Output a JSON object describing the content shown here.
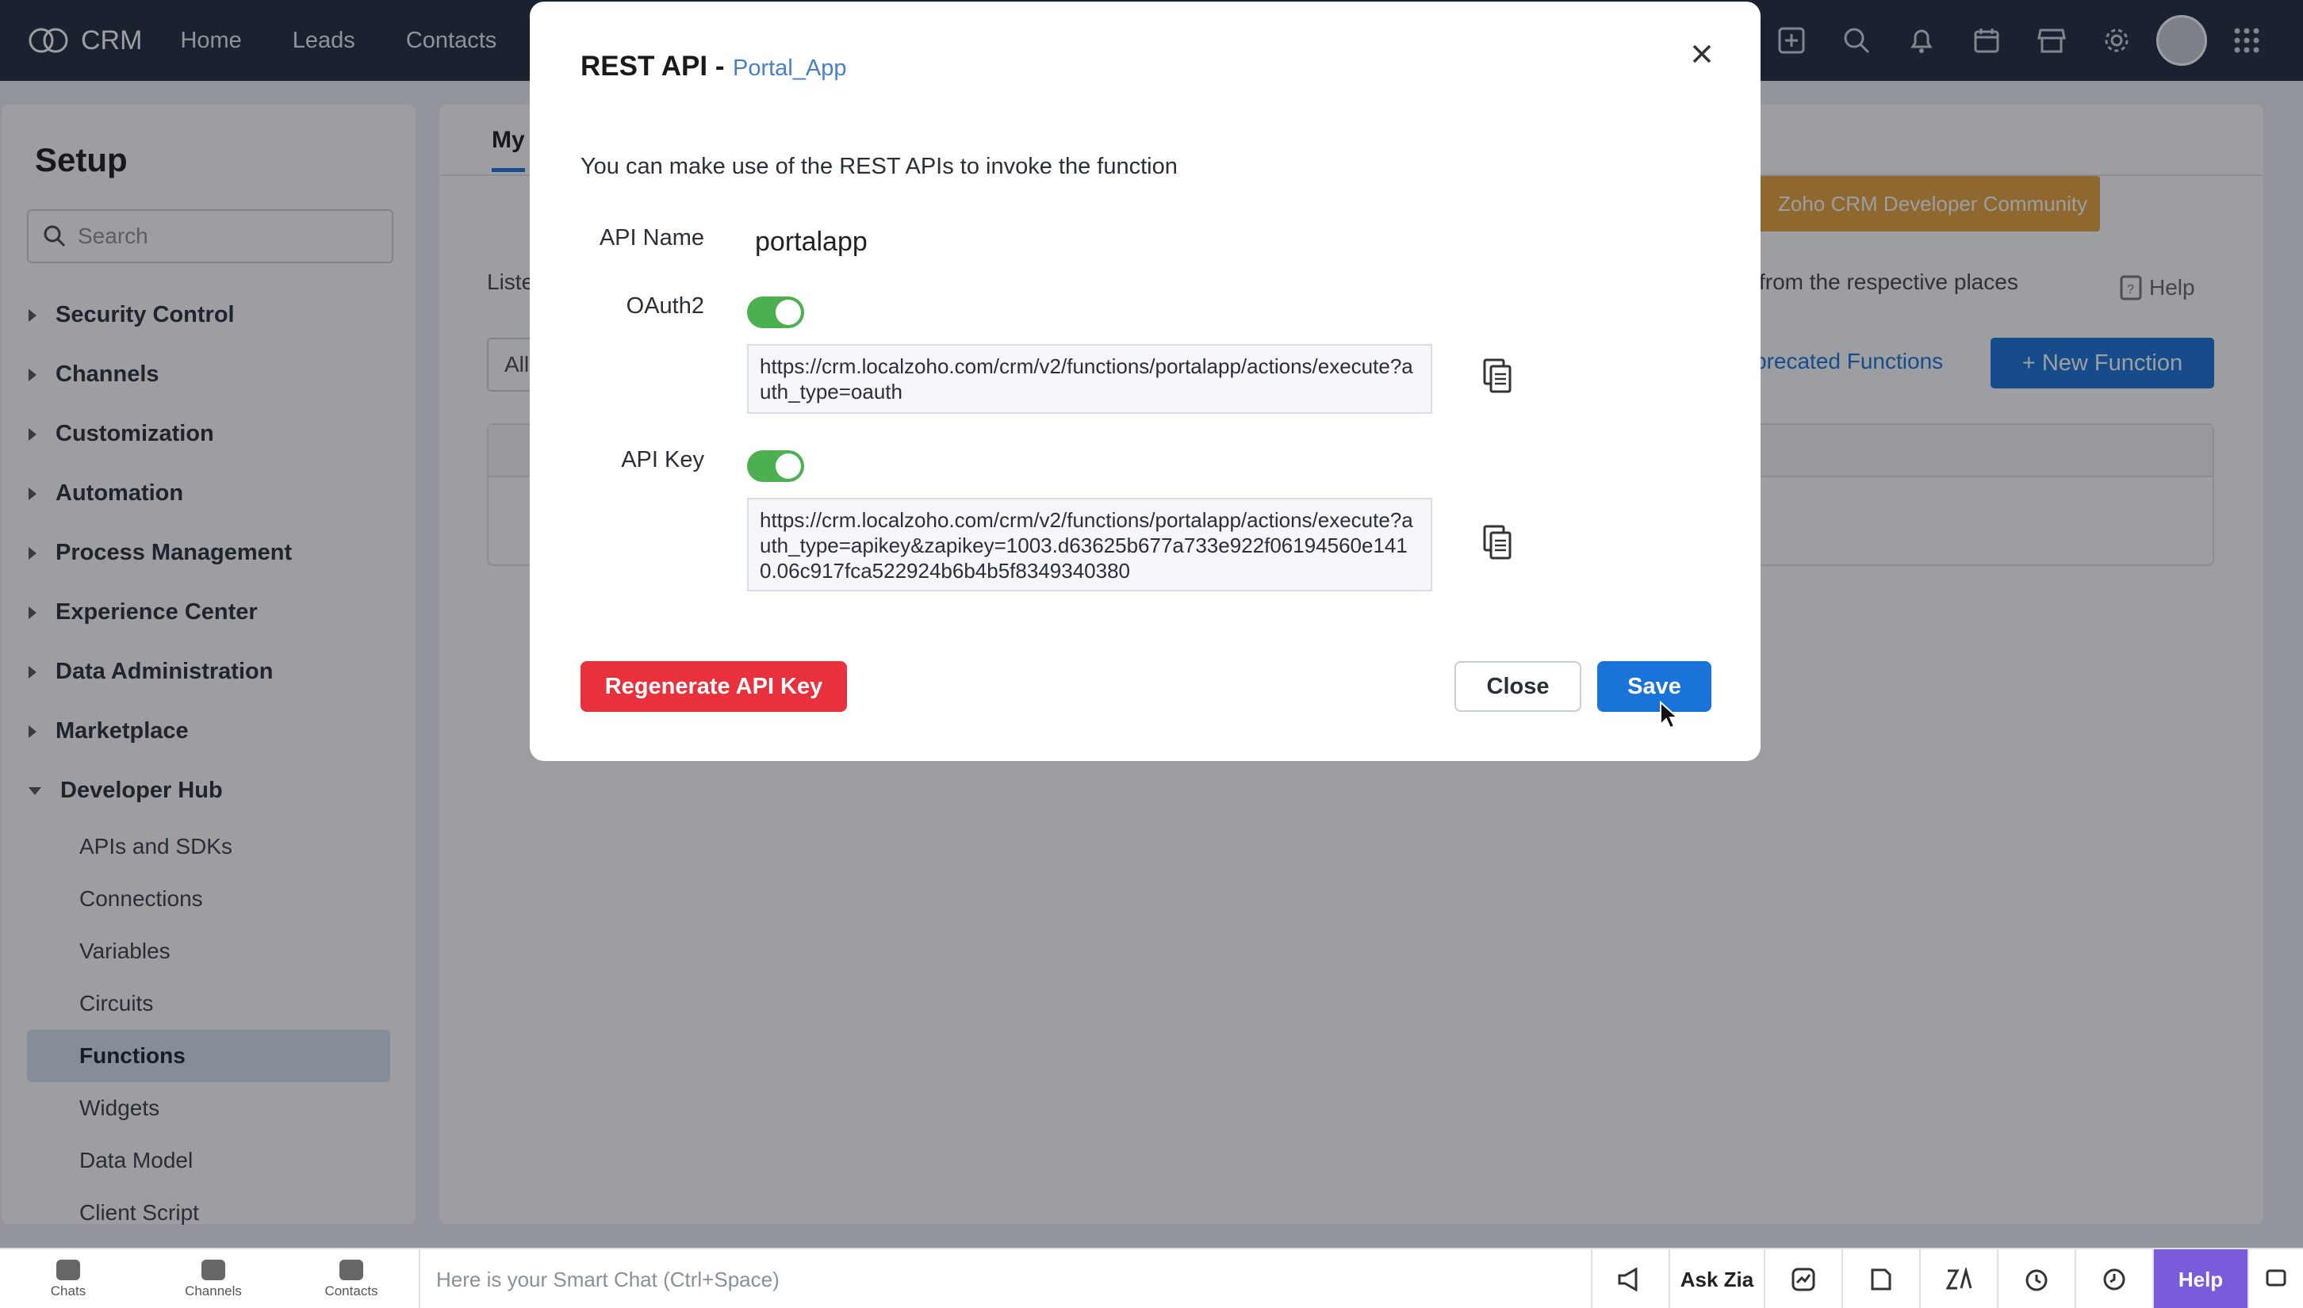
{
  "app": {
    "name": "CRM",
    "nav": [
      "Home",
      "Leads",
      "Contacts"
    ]
  },
  "sidebar": {
    "title": "Setup",
    "search_placeholder": "Search",
    "sections": [
      {
        "label": "Security Control"
      },
      {
        "label": "Channels"
      },
      {
        "label": "Customization"
      },
      {
        "label": "Automation"
      },
      {
        "label": "Process Management"
      },
      {
        "label": "Experience Center"
      },
      {
        "label": "Data Administration"
      },
      {
        "label": "Marketplace"
      },
      {
        "label": "Developer Hub"
      }
    ],
    "developer_hub_items": [
      {
        "label": "APIs and SDKs"
      },
      {
        "label": "Connections"
      },
      {
        "label": "Variables"
      },
      {
        "label": "Circuits"
      },
      {
        "label": "Functions"
      },
      {
        "label": "Widgets"
      },
      {
        "label": "Data Model"
      },
      {
        "label": "Client Script"
      }
    ]
  },
  "main": {
    "tab": "My",
    "community_banner": "Zoho CRM Developer Community",
    "list_text": "Liste",
    "places_text": "from the respective places",
    "help_label": "Help",
    "deprecated_link": "precated Functions",
    "new_function": "+ New Function",
    "filter_value": "All"
  },
  "modal": {
    "title": "REST API -",
    "subtitle": "Portal_App",
    "description": "You can make use of the REST APIs to invoke the function",
    "api_name_label": "API Name",
    "api_name_value": "portalapp",
    "oauth_label": "OAuth2",
    "oauth_url": "https://crm.localzoho.com/crm/v2/functions/portalapp/actions/execute?auth_type=oauth",
    "apikey_label": "API Key",
    "apikey_url": "https://crm.localzoho.com/crm/v2/functions/portalapp/actions/execute?auth_type=apikey&zapikey=1003.d63625b677a733e922f06194560e1410.06c917fca522924b6b4b5f8349340380",
    "regen_label": "Regenerate API Key",
    "close_label": "Close",
    "save_label": "Save"
  },
  "bottom": {
    "chats": "Chats",
    "channels": "Channels",
    "contacts": "Contacts",
    "smartchat_placeholder": "Here is your Smart Chat (Ctrl+Space)",
    "ask_zia": "Ask Zia",
    "help": "Help"
  },
  "colors": {
    "topbar": "#1f2a3d",
    "accent": "#1a73d9",
    "danger": "#e9303d",
    "toggle_on": "#4caf50",
    "community": "#e9a23b"
  }
}
